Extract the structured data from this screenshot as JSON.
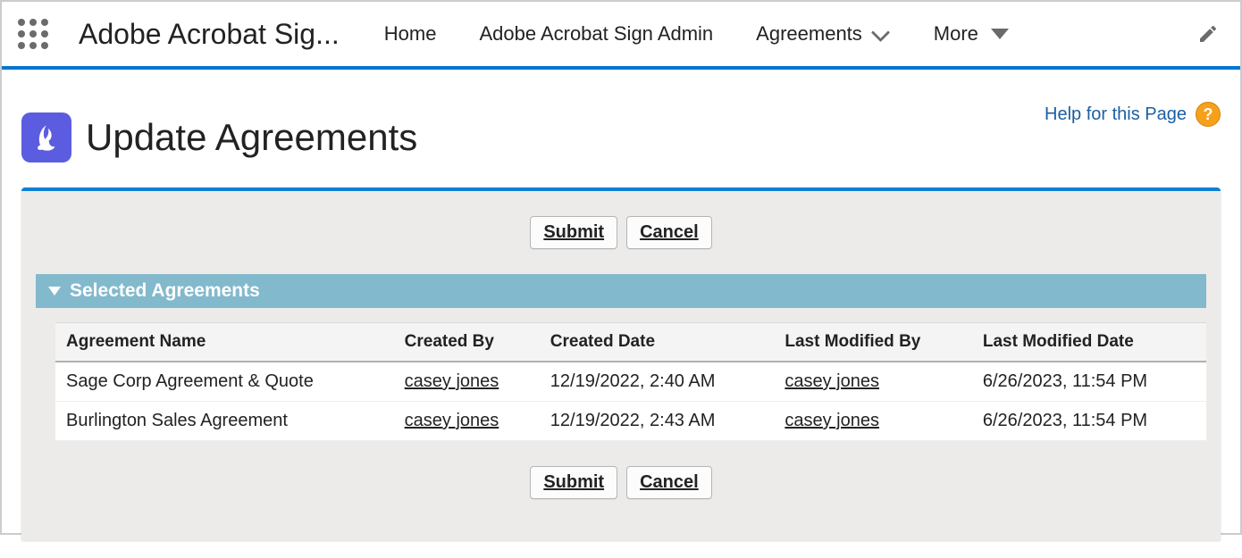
{
  "nav": {
    "app_title": "Adobe Acrobat Sig...",
    "items": [
      "Home",
      "Adobe Acrobat Sign Admin",
      "Agreements",
      "More"
    ]
  },
  "page": {
    "title": "Update Agreements",
    "help_label": "Help for this Page"
  },
  "buttons": {
    "submit": "Submit",
    "cancel": "Cancel"
  },
  "section": {
    "title": "Selected Agreements"
  },
  "table": {
    "columns": [
      "Agreement Name",
      "Created By",
      "Created Date",
      "Last Modified By",
      "Last Modified Date"
    ],
    "rows": [
      {
        "name": "Sage Corp Agreement & Quote",
        "created_by": "casey jones",
        "created_date": "12/19/2022, 2:40 AM",
        "modified_by": "casey jones",
        "modified_date": "6/26/2023, 11:54 PM"
      },
      {
        "name": "Burlington Sales Agreement",
        "created_by": "casey jones",
        "created_date": "12/19/2022, 2:43 AM",
        "modified_by": "casey jones",
        "modified_date": "6/26/2023, 11:54 PM"
      }
    ]
  }
}
